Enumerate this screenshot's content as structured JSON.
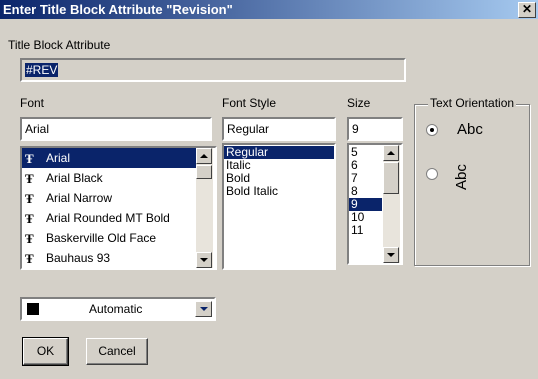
{
  "window": {
    "title": "Enter Title Block Attribute \"Revision\"",
    "close_glyph": "✕"
  },
  "attribute": {
    "label": "Title Block Attribute",
    "value": "#REV"
  },
  "font": {
    "label": "Font",
    "value": "Arial",
    "items": [
      "Arial",
      "Arial Black",
      "Arial Narrow",
      "Arial Rounded MT Bold",
      "Baskerville Old Face",
      "Bauhaus 93"
    ],
    "selected_index": 0,
    "icon_glyph": "Ŧ"
  },
  "style": {
    "label": "Font Style",
    "value": "Regular",
    "items": [
      "Regular",
      "Italic",
      "Bold",
      "Bold Italic"
    ],
    "selected_index": 0
  },
  "size": {
    "label": "Size",
    "value": "9",
    "items": [
      "5",
      "6",
      "7",
      "8",
      "9",
      "10",
      "11"
    ],
    "selected_index": 4
  },
  "orientation": {
    "label": "Text Orientation",
    "options": [
      {
        "text": "Abc",
        "selected": true
      },
      {
        "text": "Abc",
        "selected": false
      }
    ]
  },
  "color": {
    "label": "Automatic",
    "swatch": "#000000"
  },
  "buttons": {
    "ok": "OK",
    "cancel": "Cancel"
  },
  "colors": {
    "title_start": "#0a246a",
    "title_end": "#a6caf0",
    "highlight": "#0a246a",
    "face": "#d4d0c8"
  }
}
